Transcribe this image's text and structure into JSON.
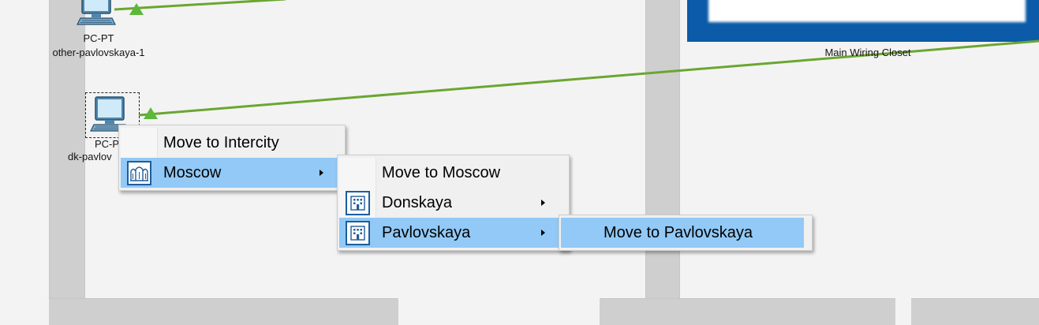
{
  "workspace": {
    "devices": [
      {
        "model_label": "PC-PT",
        "name_label": "other-pavlovskaya-1",
        "icon": "pc-icon"
      },
      {
        "model_label": "PC-P",
        "name_label": "dk-pavlov",
        "icon": "pc-icon",
        "selected": true
      }
    ],
    "closet": {
      "label": "Main Wiring Closet"
    },
    "link_status_icon": "link-up-triangle-icon"
  },
  "context_menu": {
    "items": [
      {
        "label": "Move to Intercity"
      },
      {
        "label": "Moscow",
        "icon": "city-icon",
        "has_submenu": true,
        "highlighted": true
      }
    ]
  },
  "submenu_moscow": {
    "items": [
      {
        "label": "Move to Moscow"
      },
      {
        "label": "Donskaya",
        "icon": "building-icon",
        "has_submenu": true
      },
      {
        "label": "Pavlovskaya",
        "icon": "building-icon",
        "has_submenu": true,
        "highlighted": true
      }
    ]
  },
  "submenu_pavlovskaya": {
    "items": [
      {
        "label": "Move to Pavlovskaya",
        "highlighted": true
      }
    ]
  },
  "colors": {
    "highlight": "#92c9f6",
    "link": "#6ba631",
    "closet": "#0b5ba8",
    "wall": "#cfcfcf",
    "floor": "#f3f3f3"
  }
}
